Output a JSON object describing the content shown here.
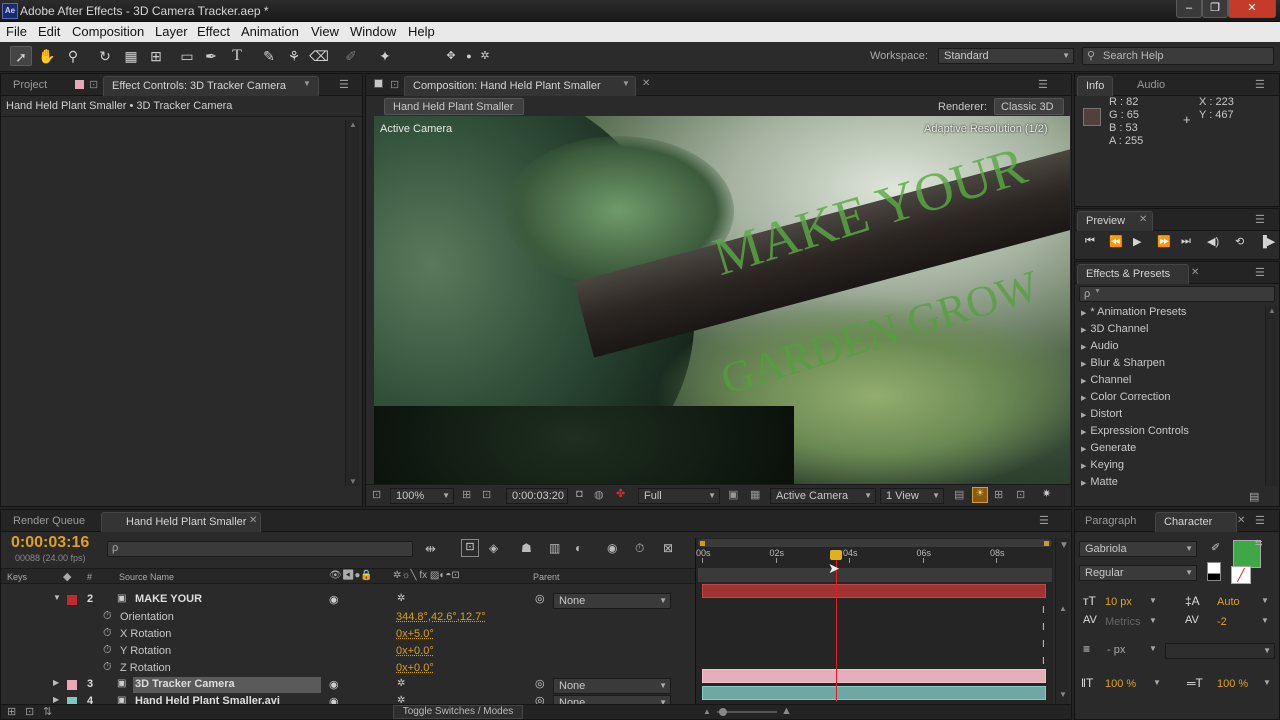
{
  "window": {
    "title": "Adobe After Effects - 3D Camera Tracker.aep *",
    "app_icon": "Ae"
  },
  "menu": [
    "File",
    "Edit",
    "Composition",
    "Layer",
    "Effect",
    "Animation",
    "View",
    "Window",
    "Help"
  ],
  "toolbar": {
    "workspace_label": "Workspace:",
    "workspace_value": "Standard",
    "search_placeholder": "Search Help"
  },
  "project_panel": {
    "tab_project": "Project",
    "tab_effect_controls": "Effect Controls: 3D Tracker Camera",
    "breadcrumb": "Hand Held Plant Smaller • 3D Tracker Camera"
  },
  "composition": {
    "tab": "Composition: Hand Held Plant Smaller",
    "comp_button": "Hand Held Plant Smaller",
    "renderer_label": "Renderer:",
    "renderer_value": "Classic 3D",
    "viewer_label": "Active Camera",
    "adaptive": "Adaptive Resolution (1/2)",
    "overlay_line1": "MAKE YOUR",
    "overlay_line2": "GARDEN GROW",
    "zoom": "100%",
    "timecode": "0:00:03:20",
    "resolution": "Full",
    "camera": "Active Camera",
    "views": "1 View"
  },
  "info": {
    "tab_info": "Info",
    "tab_audio": "Audio",
    "r": "R : 82",
    "g": "G : 65",
    "b": "B : 53",
    "a": "A : 255",
    "x": "X : 223",
    "y": "Y : 467",
    "swatch": "#52413a"
  },
  "preview": {
    "tab": "Preview"
  },
  "effects_presets": {
    "tab": "Effects & Presets",
    "search_prefix": "ρ",
    "items": [
      "* Animation Presets",
      "3D Channel",
      "Audio",
      "Blur & Sharpen",
      "Channel",
      "Color Correction",
      "Distort",
      "Expression Controls",
      "Generate",
      "Keying",
      "Matte"
    ]
  },
  "timeline": {
    "tab_render_queue": "Render Queue",
    "tab_comp": "Hand Held Plant Smaller",
    "current_time": "0:00:03:16",
    "frame_info": "00088 (24.00 fps)",
    "col_keys": "Keys",
    "col_num": "#",
    "col_source": "Source Name",
    "col_parent": "Parent",
    "ruler": [
      "00s",
      "02s",
      "04s",
      "06s",
      "08s"
    ],
    "layers": [
      {
        "num": "2",
        "name": "MAKE YOUR",
        "parent": "None",
        "color": "#c02a2a"
      },
      {
        "num": "3",
        "name": "3D Tracker Camera",
        "parent": "None",
        "color": "#e8a8b8"
      },
      {
        "num": "4",
        "name": "Hand Held Plant Smaller.avi",
        "parent": "None",
        "color": "#7ec8c0"
      }
    ],
    "props": [
      {
        "name": "Orientation",
        "value": "344.8°,42.6°,12.7°"
      },
      {
        "name": "X Rotation",
        "value": "0x+5.0°"
      },
      {
        "name": "Y Rotation",
        "value": "0x+0.0°"
      },
      {
        "name": "Z Rotation",
        "value": "0x+0.0°"
      }
    ],
    "toggle": "Toggle Switches / Modes"
  },
  "character": {
    "tab_paragraph": "Paragraph",
    "tab_character": "Character",
    "font": "Gabriola",
    "style": "Regular",
    "size": "10 px",
    "leading": "Auto",
    "kerning": "Metrics",
    "tracking": "-2",
    "stroke": "- px",
    "vscale": "100 %",
    "hscale": "100 %",
    "fill_color": "#3da845"
  }
}
